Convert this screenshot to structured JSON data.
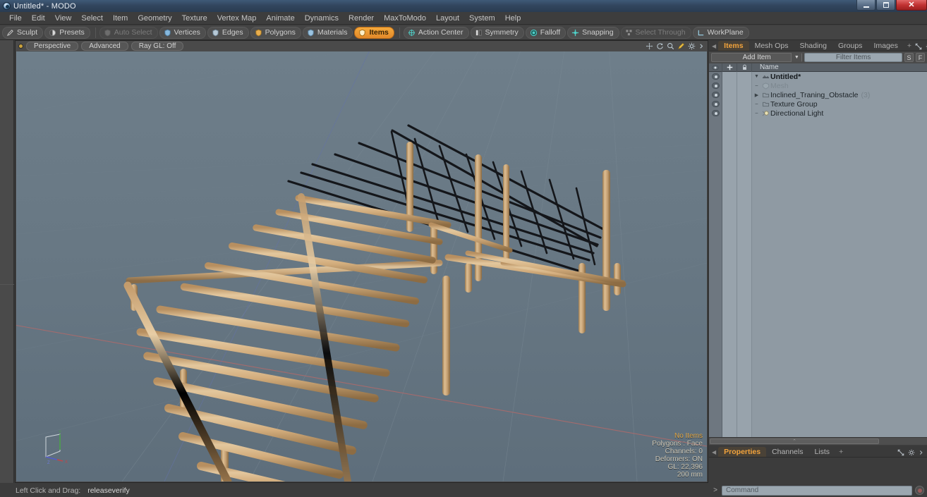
{
  "window": {
    "title": "Untitled* - MODO",
    "app_icon": "modo-sphere-icon",
    "controls": {
      "minimize": "minimize-icon",
      "maximize": "maximize-icon",
      "close": "close-icon"
    }
  },
  "menubar": {
    "items": [
      {
        "label": "File"
      },
      {
        "label": "Edit"
      },
      {
        "label": "View"
      },
      {
        "label": "Select"
      },
      {
        "label": "Item"
      },
      {
        "label": "Geometry"
      },
      {
        "label": "Texture"
      },
      {
        "label": "Vertex Map"
      },
      {
        "label": "Animate"
      },
      {
        "label": "Dynamics"
      },
      {
        "label": "Render"
      },
      {
        "label": "MaxToModo"
      },
      {
        "label": "Layout"
      },
      {
        "label": "System"
      },
      {
        "label": "Help"
      }
    ]
  },
  "modebar": {
    "groups": [
      {
        "buttons": [
          {
            "label": "Sculpt",
            "icon": "pencil-icon",
            "state": "normal"
          },
          {
            "label": "Presets",
            "icon": "sphere-icon",
            "state": "normal"
          }
        ]
      },
      {
        "buttons": [
          {
            "label": "Auto Select",
            "icon": "shield-icon",
            "state": "disabled"
          },
          {
            "label": "Vertices",
            "icon": "vertex-icon",
            "state": "normal"
          },
          {
            "label": "Edges",
            "icon": "edge-icon",
            "state": "normal"
          },
          {
            "label": "Polygons",
            "icon": "polygon-icon",
            "state": "normal"
          },
          {
            "label": "Materials",
            "icon": "material-icon",
            "state": "normal"
          },
          {
            "label": "Items",
            "icon": "items-icon",
            "state": "active"
          }
        ]
      },
      {
        "buttons": [
          {
            "label": "Action Center",
            "icon": "target-icon",
            "state": "normal"
          },
          {
            "label": "Symmetry",
            "icon": "symmetry-icon",
            "state": "normal"
          },
          {
            "label": "Falloff",
            "icon": "falloff-icon",
            "state": "normal"
          },
          {
            "label": "Snapping",
            "icon": "snapping-icon",
            "state": "normal"
          },
          {
            "label": "Select Through",
            "icon": "select-through-icon",
            "state": "disabled"
          },
          {
            "label": "WorkPlane",
            "icon": "workplane-icon",
            "state": "normal"
          }
        ]
      }
    ]
  },
  "viewport": {
    "header": {
      "indicator": "viewport-active-dot",
      "chips": [
        {
          "label": "Perspective"
        },
        {
          "label": "Advanced"
        },
        {
          "label": "Ray GL: Off"
        }
      ],
      "icons": [
        {
          "name": "pan-icon"
        },
        {
          "name": "rotate-icon"
        },
        {
          "name": "zoom-icon"
        },
        {
          "name": "highlight-icon"
        },
        {
          "name": "gear-icon"
        },
        {
          "name": "chevron-right-icon"
        }
      ]
    },
    "stats": {
      "selection": "No Items",
      "polygons": "Polygons : Face",
      "channels": "Channels: 0",
      "deformers": "Deformers: ON",
      "gl": "GL: 22,396",
      "grid": "200 mm"
    },
    "axis_gizmo": {
      "x_label": "X",
      "y_label": "Y",
      "z_label": "Z",
      "x_color": "#c0464a",
      "y_color": "#4da04d",
      "z_color": "#4a5fd0"
    },
    "model": {
      "name": "Inclined training obstacle - wooden log frame",
      "wood_light": "#d9b489",
      "wood_mid": "#c49b6d",
      "wood_dark": "#9c7748",
      "rope_color": "#14161a"
    },
    "background": {
      "sky_top": "#6d7d89",
      "sky_bottom": "#5f6f7c",
      "grid_line": "#7c8b96",
      "axis_x_color": "#a96a6a",
      "axis_z_color": "#6a78a9"
    }
  },
  "statusbar": {
    "key": "Left Click and Drag:",
    "value": "releaseverify"
  },
  "right_panel": {
    "tabs": [
      {
        "label": "Items",
        "active": true
      },
      {
        "label": "Mesh Ops",
        "active": false
      },
      {
        "label": "Shading",
        "active": false
      },
      {
        "label": "Groups",
        "active": false
      },
      {
        "label": "Images",
        "active": false
      },
      {
        "label": "+",
        "active": false
      }
    ],
    "tab_icons": [
      {
        "name": "expand-icon"
      },
      {
        "name": "gear-icon"
      },
      {
        "name": "chevron-right-icon"
      }
    ],
    "toolbar": {
      "add_item_label": "Add Item",
      "add_item_caret": "chevron-down-icon",
      "filter_placeholder": "Filter Items",
      "btn_s": "S",
      "btn_f": "F"
    },
    "list_header": {
      "eye": "eye-icon",
      "plus": "plus-icon",
      "lock": "lock-icon",
      "name": "Name"
    },
    "items": [
      {
        "label": "Untitled*",
        "icon": "scene-icon",
        "depth": 0,
        "twisty": "down",
        "visible": true,
        "dim": false,
        "count": ""
      },
      {
        "label": "Mesh",
        "icon": "mesh-icon",
        "depth": 1,
        "twisty": "dash",
        "visible": true,
        "dim": true,
        "count": ""
      },
      {
        "label": "Inclined_Traning_Obstacle",
        "icon": "group-icon",
        "depth": 1,
        "twisty": "right",
        "visible": true,
        "dim": false,
        "count": "(3)"
      },
      {
        "label": "Texture Group",
        "icon": "group-icon",
        "depth": 1,
        "twisty": "dash",
        "visible": true,
        "dim": false,
        "count": ""
      },
      {
        "label": "Directional Light",
        "icon": "light-icon",
        "depth": 1,
        "twisty": "dash",
        "visible": true,
        "dim": false,
        "count": ""
      }
    ],
    "bottom_tabs": [
      {
        "label": "Properties",
        "active": true
      },
      {
        "label": "Channels",
        "active": false
      },
      {
        "label": "Lists",
        "active": false
      },
      {
        "label": "+",
        "active": false
      }
    ]
  },
  "command_bar": {
    "prompt": ">",
    "placeholder": "Command",
    "record_button": "record-icon"
  },
  "colors": {
    "accent_orange": "#f2a33c",
    "panel_bg": "#3c3c3c",
    "toolbar_bg": "#4a4a4a",
    "list_bg": "#8f9aa3",
    "titlebar_blue": "#32465e"
  }
}
